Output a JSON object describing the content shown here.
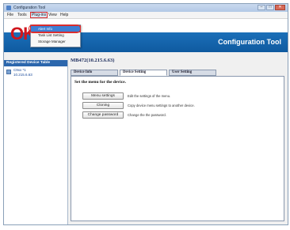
{
  "window": {
    "title": "Configuration Tool",
    "buttons": {
      "minimize": "–",
      "maximize": "□",
      "close": "✕"
    }
  },
  "menubar": {
    "items": [
      "File",
      "Tools",
      "Plug-ins",
      "View",
      "Help"
    ]
  },
  "dropdown": {
    "items": [
      "Alert Info",
      "Task List Setting",
      "Storage Manager"
    ],
    "highlighted_index": 0
  },
  "header": {
    "logo": "OKI",
    "title": "Configuration Tool"
  },
  "sidebar": {
    "heading": "Registered Device Table",
    "devices": [
      {
        "name": "C9xx *1",
        "ip": "10.215.6.63"
      }
    ]
  },
  "main": {
    "device_title": "MB472(10.215.6.63)",
    "tabs": [
      "Device Info",
      "Device Setting",
      "User Setting"
    ],
    "active_tab": 1,
    "panel_heading": "Set the menu for the device.",
    "actions": [
      {
        "button": "Menu settings",
        "description": "Edit the settings of the menu."
      },
      {
        "button": "Cloning",
        "description": "Copy device menu settings to another device."
      },
      {
        "button": "Change password",
        "description": "Change the the password."
      }
    ]
  },
  "colors": {
    "brand_red": "#d0161d",
    "header_blue": "#1b6fb8",
    "sidebar_head": "#2c67ad",
    "highlight": "#e03030"
  }
}
